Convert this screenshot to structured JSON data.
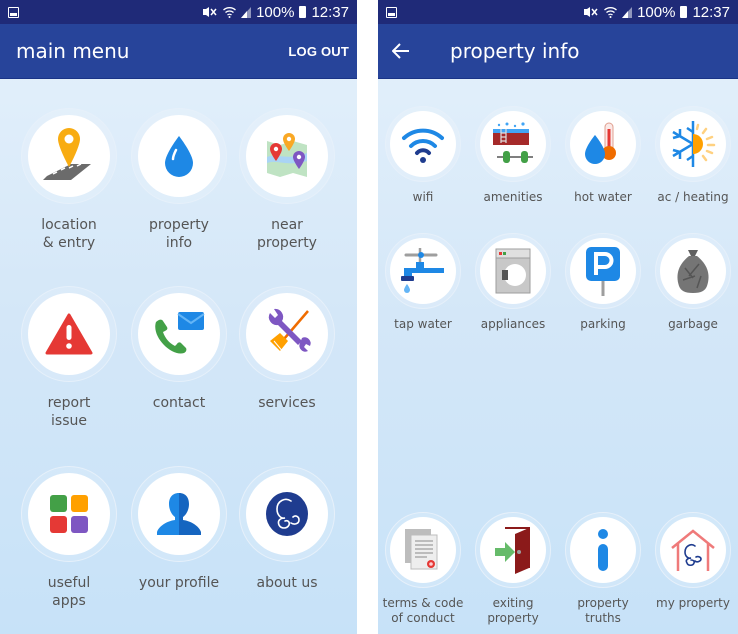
{
  "status_bar": {
    "icons": [
      "gallery-icon",
      "mute-icon",
      "wifi-icon",
      "signal-icon",
      "battery-icon"
    ],
    "battery": "100%",
    "time": "12:37"
  },
  "main_menu": {
    "title": "main menu",
    "logout_label": "LOG OUT",
    "items": [
      {
        "label": "location\n& entry",
        "icon": "location-pin-road-icon"
      },
      {
        "label": "property\ninfo",
        "icon": "water-drop-icon"
      },
      {
        "label": "near\nproperty",
        "icon": "map-pins-icon"
      },
      {
        "label": "report\nissue",
        "icon": "warning-triangle-icon"
      },
      {
        "label": "contact",
        "icon": "phone-mail-icon"
      },
      {
        "label": "services",
        "icon": "wrench-broom-icon"
      },
      {
        "label": "useful\napps",
        "icon": "apps-grid-icon"
      },
      {
        "label": "your profile",
        "icon": "user-silhouette-icon"
      },
      {
        "label": "about us",
        "icon": "brand-logo-icon"
      }
    ]
  },
  "property_info": {
    "title": "property info",
    "back_icon": "arrow-left-icon",
    "items": [
      {
        "label": "wifi",
        "icon": "wifi-icon"
      },
      {
        "label": "amenities",
        "icon": "hot-tub-dumbbell-icon"
      },
      {
        "label": "hot water",
        "icon": "drop-thermometer-icon"
      },
      {
        "label": "ac / heating",
        "icon": "snowflake-sun-icon"
      },
      {
        "label": "tap water",
        "icon": "faucet-icon"
      },
      {
        "label": "appliances",
        "icon": "washing-machine-icon"
      },
      {
        "label": "parking",
        "icon": "parking-sign-icon"
      },
      {
        "label": "garbage",
        "icon": "garbage-bag-icon"
      },
      {
        "label": "terms & code\nof conduct",
        "icon": "document-seal-icon"
      },
      {
        "label": "exiting\nproperty",
        "icon": "exit-door-icon"
      },
      {
        "label": "property\ntruths",
        "icon": "info-icon"
      },
      {
        "label": "my property",
        "icon": "house-logo-icon"
      }
    ]
  }
}
